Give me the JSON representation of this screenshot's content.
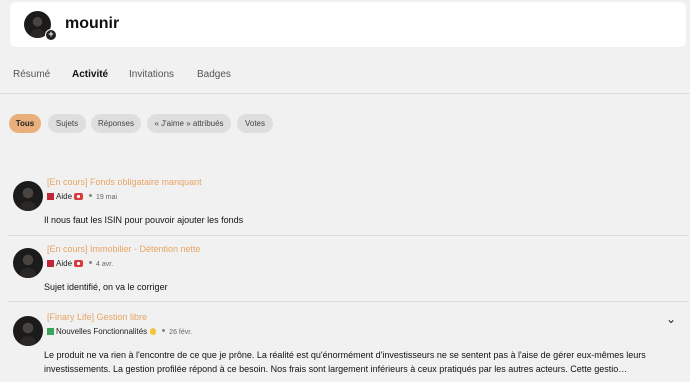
{
  "user": {
    "name": "mounir",
    "add_icon": "+"
  },
  "tabs": [
    "Résumé",
    "Activité",
    "Invitations",
    "Badges"
  ],
  "filters": [
    "Tous",
    "Sujets",
    "Réponses",
    "« J'aime » attribués",
    "Votes"
  ],
  "posts": [
    {
      "title": "[En cours] Fonds obligataire manquant",
      "category": "Aide",
      "category_color": "#c0253a",
      "date": "19 mai",
      "excerpt": "Il nous faut les ISIN pour pouvoir ajouter les fonds"
    },
    {
      "title": "[En cours] Immobilier - Détention nette",
      "category": "Aide",
      "category_color": "#c0253a",
      "date": "4 avr.",
      "excerpt": "Sujet identifié, on va le corriger"
    },
    {
      "title": "[Finary Life] Gestion libre",
      "category": "Nouvelles Fonctionnalités",
      "category_color": "#3aa35f",
      "date": "26 févr.",
      "excerpt": "Le produit ne va rien à l'encontre de ce que je prône. La réalité est qu'énormément d'investisseurs ne se sentent pas à l'aise de gérer eux-mêmes leurs investissements. La gestion profilée répond à ce besoin. Nos frais sont largement inférieurs à ceux pratiqués par les autres acteurs. Cette gestio…",
      "expand_icon": "⌄"
    }
  ],
  "colors": {
    "accent": "#eab07c",
    "link": "#e7a465"
  }
}
